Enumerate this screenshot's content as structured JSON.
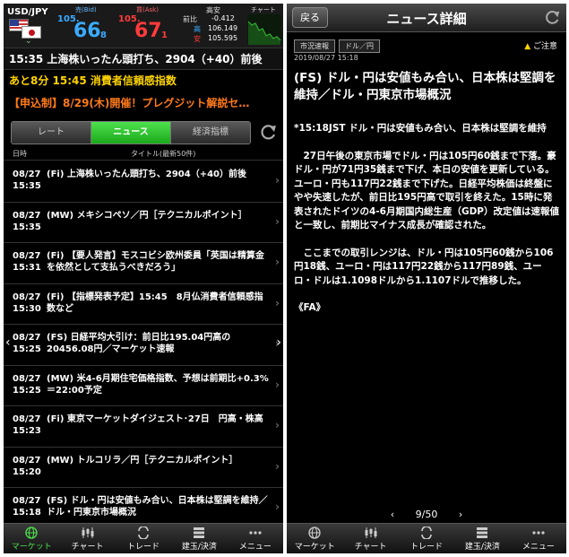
{
  "left": {
    "quote": {
      "pair": "USD/JPY",
      "bid_label": "売(Bid)",
      "ask_label": "買(Ask)",
      "bid_small": "105.",
      "bid_big": "66",
      "bid_sub": "8",
      "ask_small": "105.",
      "ask_big": "67",
      "ask_sub": "1",
      "change_label": "前比",
      "high_label": "高",
      "low_label": "安",
      "range_label": "高安",
      "change_value": "-0.412",
      "high_value": "106.149",
      "low_value": "105.595",
      "chart_label": "チャート"
    },
    "ticker_price": "15:35 上海株いったん頭打ち、2904（+40）前後",
    "ticker_event": "あと8分 15:45 消費者信頼感指数",
    "ticker_promo": "【申込制】8/29(木)開催！プレグジット解説セ…",
    "tabs": [
      "レート",
      "ニュース",
      "経済指標"
    ],
    "list_head": {
      "date": "日時",
      "title": "タイトル(最新50件)"
    },
    "news": [
      {
        "date": "08/27",
        "time": "15:35",
        "title": "(Fi) 上海株いったん頭打ち、2904（+40）前後"
      },
      {
        "date": "08/27",
        "time": "15:35",
        "title": "(MW) メキシコペソ／円［テクニカルポイント］"
      },
      {
        "date": "08/27",
        "time": "15:31",
        "title": "(Fi) 【要人発言】モスコビシ欧州委員「英国は精算金を依然として支払うべきだろう」"
      },
      {
        "date": "08/27",
        "time": "15:30",
        "title": "(Fi) 【指標発表予定】15:45　8月仏消費者信頼感指数など"
      },
      {
        "date": "08/27",
        "time": "15:25",
        "title": "(FS) 日経平均大引け：前日比195.04円高の20456.08円／マーケット速報"
      },
      {
        "date": "08/27",
        "time": "15:25",
        "title": "(MW) 米4-6月期住宅価格指数、予想は前期比+0.3%＝22:00予定"
      },
      {
        "date": "08/27",
        "time": "15:23",
        "title": "(Fi) 東京マーケットダイジェスト･27日　円高・株高"
      },
      {
        "date": "08/27",
        "time": "15:20",
        "title": "(MW) トルコリラ／円［テクニカルポイント］"
      },
      {
        "date": "08/27",
        "time": "15:18",
        "title": "(FS) ドル・円は安値もみ合い、日本株は堅調を維持／ドル・円東京市場概況"
      }
    ],
    "nav": [
      "マーケット",
      "チャート",
      "トレード",
      "建玉/決済",
      "メニュー"
    ]
  },
  "right": {
    "back": "戻る",
    "title": "ニュース詳細",
    "tags": [
      "市況速報",
      "ドル／円"
    ],
    "notice": "ご注意",
    "pubtime": "2019/08/27 15:18",
    "headline": "(FS) ドル・円は安値もみ合い、日本株は堅調を維持／ドル・円東京市場概況",
    "body": [
      "*15:18JST ドル・円は安値もみ合い、日本株は堅調を維持",
      "　27日午後の東京市場でドル・円は105円60銭まで下落。豪ドル・円が71円35銭まで下げ、本日の安値を更新している。ユーロ・円も117円22銭まで下げた。日経平均株価は終盤にやや失速したが、前日比195円高で取引を終えた。15時に発表されたドイツの4-6月期国内総生産（GDP）改定値は速報値と一致し、前期比マイナス成長が確認された。",
      "　ここまでの取引レンジは、ドル・円は105円60銭から106円18銭、ユーロ・円は117円22銭から117円89銭、ユーロ・ドルは1.1098ドルから1.1107ドルで推移した。",
      "《FA》"
    ],
    "pager": {
      "prev": "‹",
      "text": "9/50",
      "next": "›"
    },
    "nav": [
      "マーケット",
      "チャート",
      "トレード",
      "建玉/決済",
      "メニュー"
    ]
  }
}
